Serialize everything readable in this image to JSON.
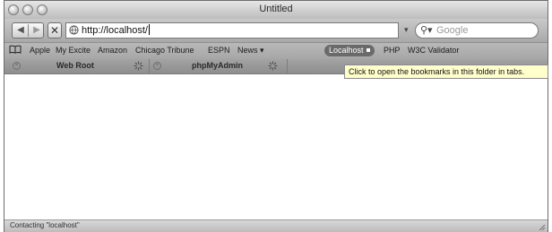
{
  "window": {
    "title": "Untitled"
  },
  "toolbar": {
    "back_icon": "back-arrow-icon",
    "forward_icon": "forward-arrow-icon",
    "stop_icon": "stop-x-icon",
    "url": "http://localhost/",
    "search_placeholder": "Google"
  },
  "bookmarks": {
    "items": [
      {
        "label": "Apple"
      },
      {
        "label": "My Excite"
      },
      {
        "label": "Amazon"
      },
      {
        "label": "Chicago Tribune"
      },
      {
        "label": "ESPN"
      },
      {
        "label": "News ▾"
      },
      {
        "label": "Localhost"
      },
      {
        "label": "PHP"
      },
      {
        "label": "W3C Validator"
      }
    ]
  },
  "tabs": [
    {
      "label": "Web Root"
    },
    {
      "label": "phpMyAdmin"
    }
  ],
  "tooltip": {
    "text": "Click to open the bookmarks in this folder in tabs."
  },
  "status": {
    "text": "Contacting \"localhost\""
  }
}
